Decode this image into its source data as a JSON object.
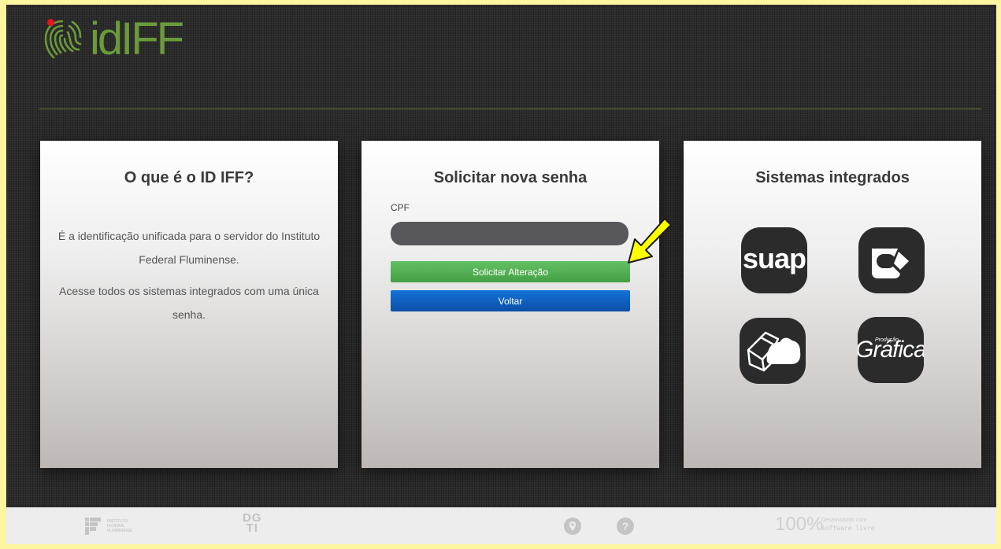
{
  "header": {
    "logo_text": "idIFF"
  },
  "about": {
    "title": "O que é o ID IFF?",
    "paragraph1": "É a identificação unificada para o servidor do Instituto Federal Fluminense.",
    "paragraph2": "Acesse todos os sistemas integrados com uma única senha."
  },
  "form": {
    "title": "Solicitar nova senha",
    "cpf_label": "CPF",
    "cpf_value": "",
    "submit_label": "Solicitar Alteração",
    "back_label": "Voltar"
  },
  "systems": {
    "title": "Sistemas integrados",
    "apps": [
      {
        "name": "suap",
        "label": "suap",
        "icon": "suap-logo-icon"
      },
      {
        "name": "mug",
        "label": "",
        "icon": "coffee-mug-icon"
      },
      {
        "name": "box-cloud",
        "label": "",
        "icon": "box-cloud-icon"
      },
      {
        "name": "grafica",
        "label": "Gráfica",
        "small_label": "Produção",
        "icon": "grafica-logo-icon"
      }
    ]
  },
  "footer": {
    "iff_text": "INSTITUTO FEDERAL FLUMINENSE",
    "dgti_top": "DG",
    "dgti_bottom": "TI",
    "pin_icon": "?",
    "help_icon": "?",
    "percent": "100%",
    "dev_line1": "Desenvolvido com",
    "dev_line2": "software livre"
  },
  "colors": {
    "accent_green": "#5cb85c",
    "primary_blue": "#0b5cc4",
    "logo_green": "#6a9a3a",
    "page_border": "#fdf5a0"
  }
}
